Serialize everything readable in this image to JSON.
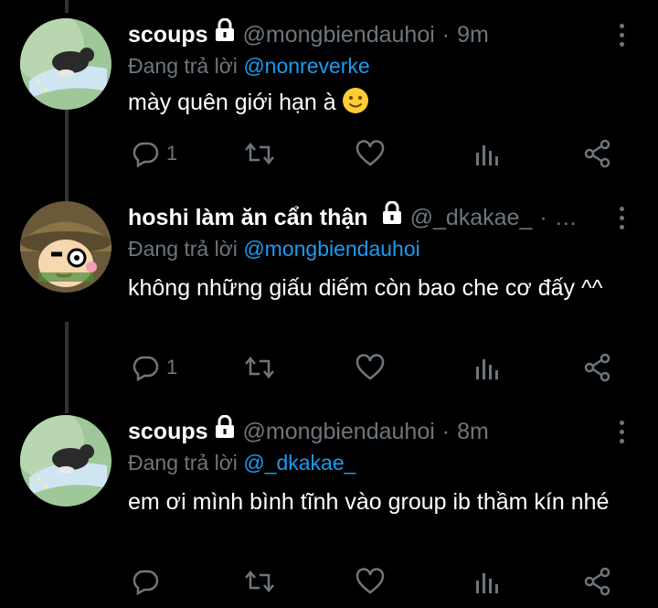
{
  "colors": {
    "background": "#000000",
    "text": "#ffffff",
    "muted": "#6e767d",
    "link": "#1d9bf0"
  },
  "tweets": [
    {
      "name": "scoups",
      "handle": "@mongbiendauhoi",
      "dot": "·",
      "time": "9m",
      "reply_prefix": "Đang trả lời",
      "reply_to": "@nonreverke",
      "text": "mày quên giới hạn à",
      "emoji": "slightly-smiling-face",
      "reply_count": "1",
      "avatar": "dog-on-grass"
    },
    {
      "name": "hoshi làm ăn cẩn thận",
      "handle": "@_dkakae_",
      "dot": "·",
      "time": "…",
      "reply_prefix": "Đang trả lời",
      "reply_to": "@mongbiendauhoi",
      "text": "không những giấu diếm còn bao che cơ đấy ^^",
      "reply_count": "1",
      "avatar": "cartoon-boy-hat"
    },
    {
      "name": "scoups",
      "handle": "@mongbiendauhoi",
      "dot": "·",
      "time": "8m",
      "reply_prefix": "Đang trả lời",
      "reply_to": "@_dkakae_",
      "text": "em ơi mình bình tĩnh vào group ib thầm kín nhé",
      "reply_count": "",
      "avatar": "dog-on-grass"
    }
  ],
  "icons": [
    "lock-icon",
    "more-icon",
    "reply-icon",
    "retweet-icon",
    "like-icon",
    "analytics-icon",
    "share-icon"
  ]
}
